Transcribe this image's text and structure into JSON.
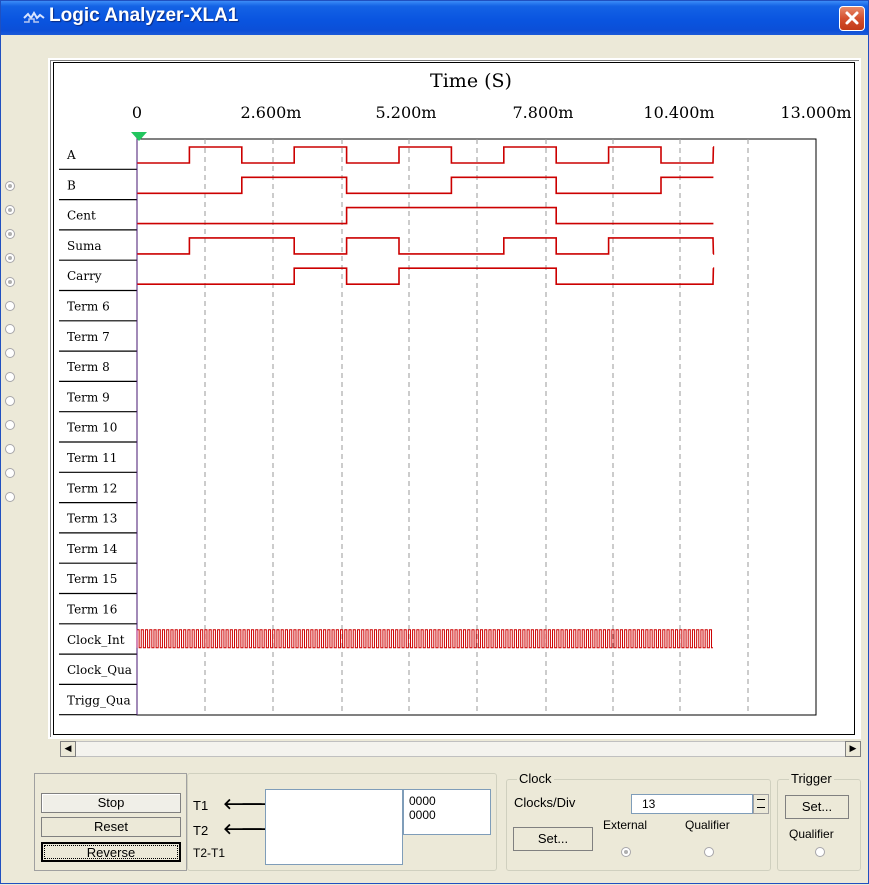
{
  "window": {
    "title": "Logic Analyzer-XLA1"
  },
  "plot": {
    "axis_title": "Time (S)",
    "ticks": [
      "0",
      "2.600m",
      "5.200m",
      "7.800m",
      "10.400m",
      "13.000m"
    ],
    "channels": [
      "A",
      "B",
      "Cent",
      "Suma",
      "Carry",
      "Term 6",
      "Term 7",
      "Term 8",
      "Term 9",
      "Term 10",
      "Term 11",
      "Term 12",
      "Term 13",
      "Term 14",
      "Term 15",
      "Term 16",
      "Clock_Int",
      "Clock_Qua",
      "Trigg_Qua"
    ],
    "signal_color": "#cc0000",
    "channel_selected": [
      true,
      true,
      true,
      true,
      true,
      false,
      false,
      false,
      false,
      false,
      false,
      false,
      false,
      false
    ]
  },
  "controls": {
    "stop_label": "Stop",
    "reset_label": "Reset",
    "reverse_label": "Reverse",
    "t1_label": "T1",
    "t2_label": "T2",
    "t2t1_label": "T2-T1",
    "t1_value": "0000",
    "t2_value": "0000"
  },
  "clock": {
    "group_title": "Clock",
    "clocks_div_label": "Clocks/Div",
    "clocks_div_value": "13",
    "set_label": "Set...",
    "external_label": "External",
    "qualifier_label": "Qualifier",
    "external_selected": true
  },
  "trigger": {
    "group_title": "Trigger",
    "set_label": "Set...",
    "qualifier_label": "Qualifier"
  }
}
